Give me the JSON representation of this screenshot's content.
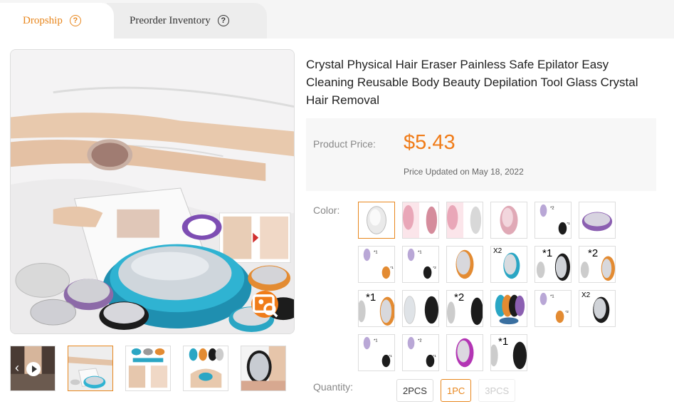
{
  "tabs": [
    {
      "label": "Dropship",
      "active": true
    },
    {
      "label": "Preorder Inventory",
      "active": false
    }
  ],
  "help_icon": "?",
  "product": {
    "title": "Crystal Physical Hair Eraser Painless Safe Epilator Easy Cleaning Reusable Body Beauty Depilation Tool Glass Crystal Hair Removal",
    "price_label": "Product Price:",
    "price": "$5.43",
    "price_updated": "Price Updated on May 18, 2022"
  },
  "color": {
    "label": "Color:",
    "swatch_tags": [
      "",
      "",
      "",
      "",
      "",
      "",
      "",
      "",
      "X2",
      "*1",
      "*2",
      "",
      "*1",
      "",
      "*2",
      "",
      "",
      "X2",
      "",
      "",
      "",
      "*1"
    ]
  },
  "quantity": {
    "label": "Quantity:",
    "options": [
      "2PCS",
      "1PC",
      "3PCS"
    ],
    "selected": "1PC",
    "disabled": "3PCS"
  },
  "colors": {
    "accent": "#e8861c",
    "price": "#f07c19",
    "teal": "#2aa6c4"
  }
}
